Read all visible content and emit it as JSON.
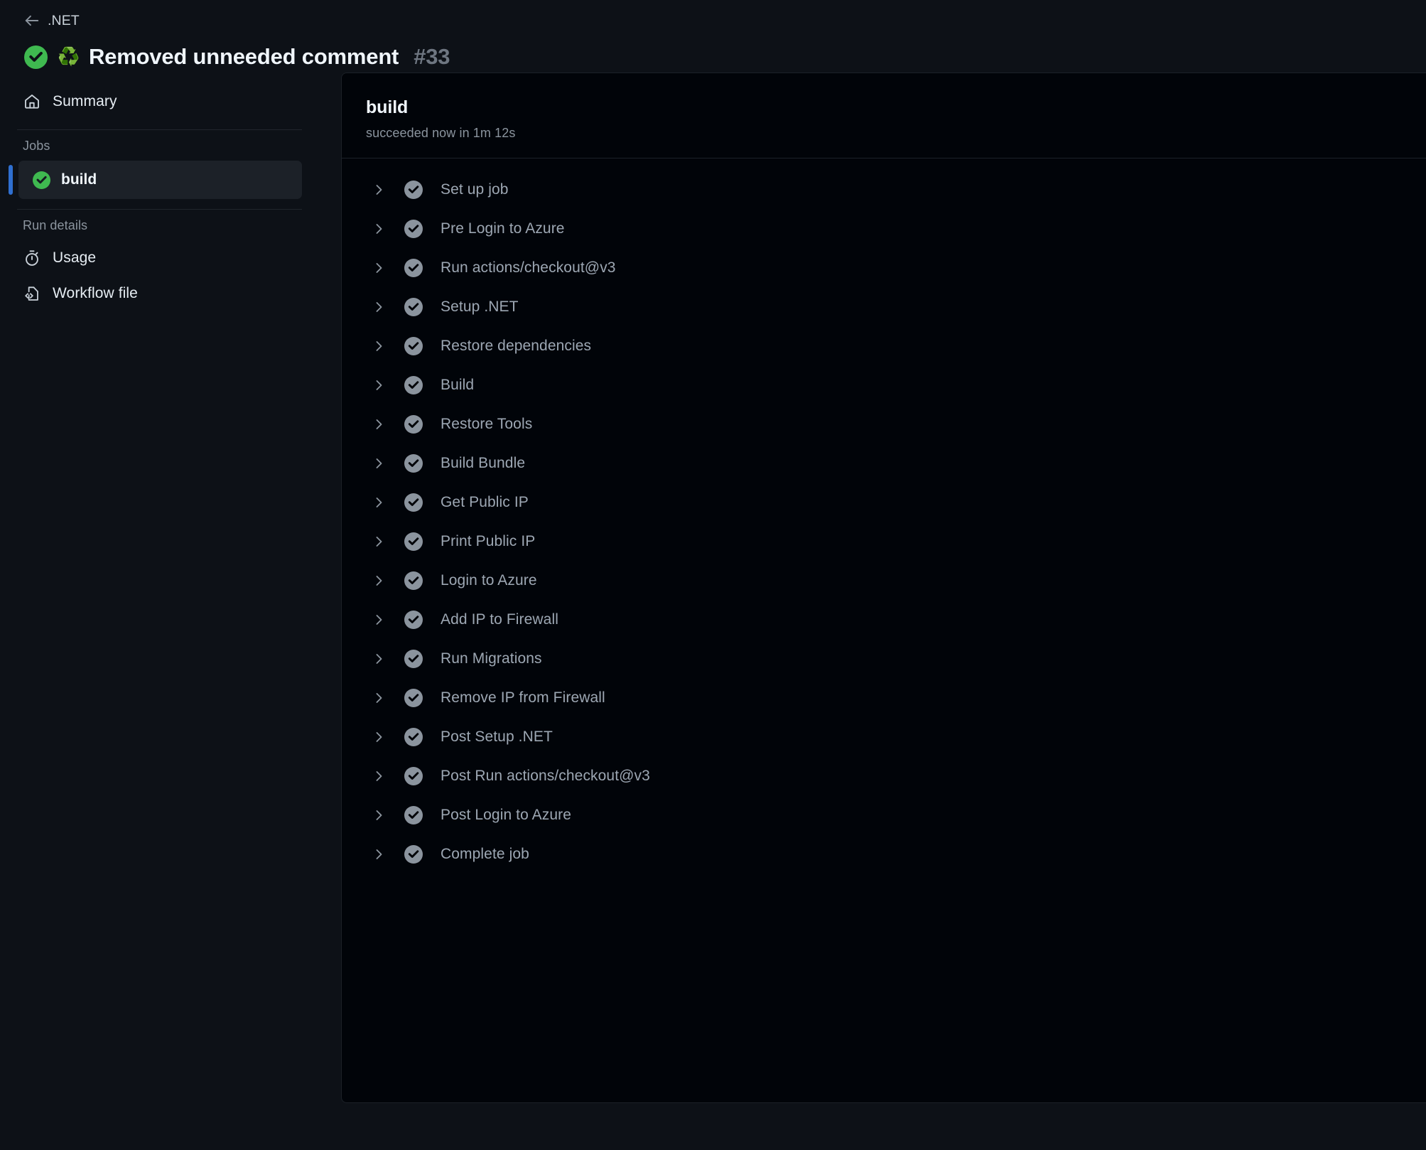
{
  "header": {
    "back_icon": "arrow-left-icon",
    "breadcrumb_label": ".NET",
    "status_icon": "check-circle-fill-icon",
    "commit_emoji": "♻️",
    "run_title": "Removed unneeded comment",
    "run_number": "#33"
  },
  "sidebar": {
    "summary": {
      "icon": "home-icon",
      "label": "Summary"
    },
    "jobs_section_title": "Jobs",
    "jobs": [
      {
        "label": "build",
        "status": "success",
        "status_icon": "check-circle-fill-icon",
        "selected": true
      }
    ],
    "run_details_title": "Run details",
    "run_details": [
      {
        "icon": "stopwatch-icon",
        "label": "Usage"
      },
      {
        "icon": "workflow-file-icon",
        "label": "Workflow file"
      }
    ]
  },
  "panel": {
    "title": "build",
    "subtitle": "succeeded now in 1m 12s",
    "steps": [
      {
        "label": "Set up job",
        "status": "success",
        "chevron": "chevron-right-icon"
      },
      {
        "label": "Pre Login to Azure",
        "status": "success",
        "chevron": "chevron-right-icon"
      },
      {
        "label": "Run actions/checkout@v3",
        "status": "success",
        "chevron": "chevron-right-icon"
      },
      {
        "label": "Setup .NET",
        "status": "success",
        "chevron": "chevron-right-icon"
      },
      {
        "label": "Restore dependencies",
        "status": "success",
        "chevron": "chevron-right-icon"
      },
      {
        "label": "Build",
        "status": "success",
        "chevron": "chevron-right-icon"
      },
      {
        "label": "Restore Tools",
        "status": "success",
        "chevron": "chevron-right-icon"
      },
      {
        "label": "Build Bundle",
        "status": "success",
        "chevron": "chevron-right-icon"
      },
      {
        "label": "Get Public IP",
        "status": "success",
        "chevron": "chevron-right-icon"
      },
      {
        "label": "Print Public IP",
        "status": "success",
        "chevron": "chevron-right-icon"
      },
      {
        "label": "Login to Azure",
        "status": "success",
        "chevron": "chevron-right-icon"
      },
      {
        "label": "Add IP to Firewall",
        "status": "success",
        "chevron": "chevron-right-icon"
      },
      {
        "label": "Run Migrations",
        "status": "success",
        "chevron": "chevron-right-icon"
      },
      {
        "label": "Remove IP from Firewall",
        "status": "success",
        "chevron": "chevron-right-icon"
      },
      {
        "label": "Post Setup .NET",
        "status": "success",
        "chevron": "chevron-right-icon"
      },
      {
        "label": "Post Run actions/checkout@v3",
        "status": "success",
        "chevron": "chevron-right-icon"
      },
      {
        "label": "Post Login to Azure",
        "status": "success",
        "chevron": "chevron-right-icon"
      },
      {
        "label": "Complete job",
        "status": "success",
        "chevron": "chevron-right-icon"
      }
    ]
  },
  "colors": {
    "success_green": "#3fb950",
    "accent_blue": "#2f6fd0",
    "page_bg": "#0d1117",
    "panel_bg": "#010409",
    "step_status_gray": "#8b949e"
  }
}
